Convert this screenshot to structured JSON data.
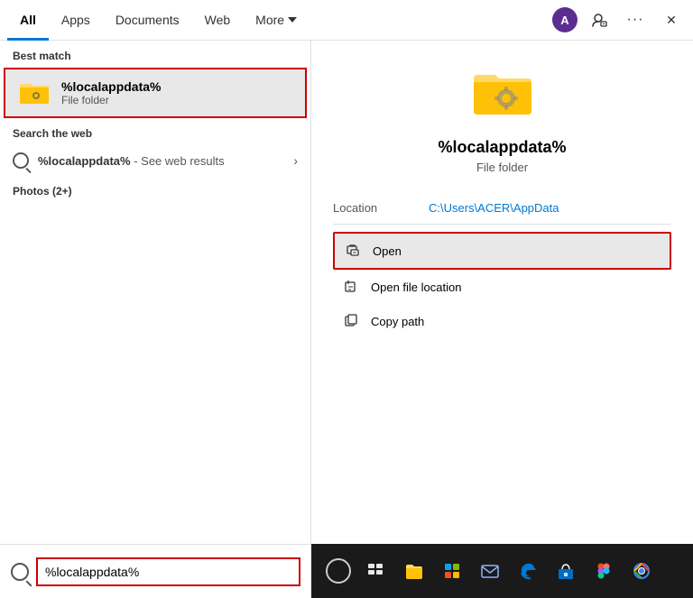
{
  "tabs": {
    "items": [
      {
        "label": "All",
        "active": true
      },
      {
        "label": "Apps",
        "active": false
      },
      {
        "label": "Documents",
        "active": false
      },
      {
        "label": "Web",
        "active": false
      },
      {
        "label": "More",
        "active": false,
        "has_arrow": true
      }
    ]
  },
  "header": {
    "avatar_letter": "A",
    "more_dots": "···",
    "close": "✕"
  },
  "left_panel": {
    "best_match_label": "Best match",
    "best_match_name": "%localappdata%",
    "best_match_sub": "File folder",
    "web_section_label": "Search the web",
    "web_query": "%localappdata%",
    "web_suffix": " - See web results",
    "photos_label": "Photos (2+)"
  },
  "right_panel": {
    "name": "%localappdata%",
    "sub": "File folder",
    "location_label": "Location",
    "location_value": "C:\\Users\\ACER\\AppData",
    "actions": [
      {
        "label": "Open",
        "highlighted": true,
        "icon": "open-icon"
      },
      {
        "label": "Open file location",
        "highlighted": false,
        "icon": "file-location-icon"
      },
      {
        "label": "Copy path",
        "highlighted": false,
        "icon": "copy-icon"
      }
    ]
  },
  "search_bar": {
    "value": "%localappdata%",
    "placeholder": ""
  },
  "taskbar": {
    "icons": [
      {
        "name": "cortana-icon",
        "type": "circle"
      },
      {
        "name": "taskview-icon",
        "type": "taskview"
      },
      {
        "name": "explorer-icon",
        "type": "folder"
      },
      {
        "name": "taskbar-icon4",
        "type": "grid"
      },
      {
        "name": "mail-icon",
        "type": "mail"
      },
      {
        "name": "edge-icon",
        "type": "edge"
      },
      {
        "name": "store-icon",
        "type": "store"
      },
      {
        "name": "figma-icon",
        "type": "figma"
      },
      {
        "name": "chrome-icon",
        "type": "chrome"
      }
    ]
  }
}
